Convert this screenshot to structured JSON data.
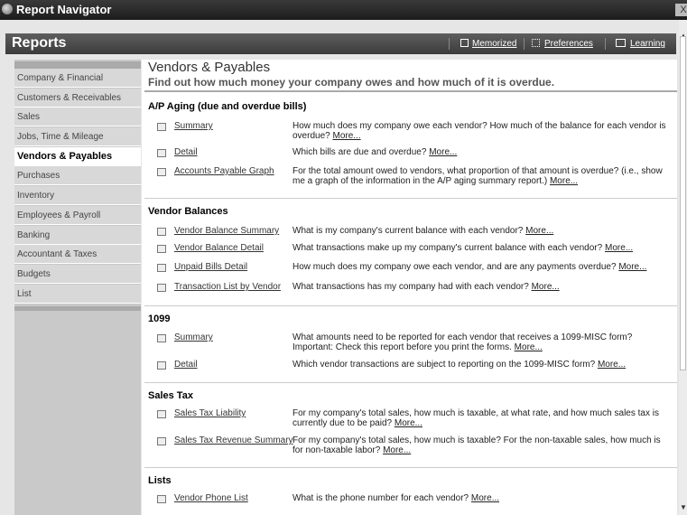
{
  "window": {
    "title": "Report Navigator",
    "close": "X"
  },
  "header": {
    "title": "Reports",
    "memorized": "Memorized",
    "preferences": "Preferences",
    "learning": "Learning"
  },
  "sidebar": {
    "items": [
      "Company & Financial",
      "Customers & Receivables",
      "Sales",
      "Jobs, Time & Mileage",
      "Vendors & Payables",
      "Purchases",
      "Inventory",
      "Employees & Payroll",
      "Banking",
      "Accountant & Taxes",
      "Budgets",
      "List"
    ],
    "active": "Vendors & Payables"
  },
  "page": {
    "title": "Vendors & Payables",
    "subtitle": "Find out how much money your company owes and how much of it is overdue."
  },
  "more": "More...",
  "sections": [
    {
      "title": "A/P Aging (due and overdue bills)",
      "reports": [
        {
          "name": "Summary",
          "desc": "How much does my company owe each vendor? How much of the balance for each vendor is overdue?"
        },
        {
          "name": "Detail",
          "desc": "Which bills are due and overdue?"
        },
        {
          "name": "Accounts Payable Graph",
          "desc": "For the total amount owed to vendors, what proportion of that amount is overdue? (i.e., show me a graph of the information in the A/P aging summary report.)"
        }
      ]
    },
    {
      "title": "Vendor Balances",
      "reports": [
        {
          "name": "Vendor Balance Summary",
          "desc": "What is my company's current balance with each vendor?"
        },
        {
          "name": "Vendor Balance Detail",
          "desc": "What transactions make up my company's current balance with each vendor?"
        },
        {
          "name": "Unpaid Bills Detail",
          "desc": "How much does my company owe each vendor, and are any payments overdue?"
        },
        {
          "name": "Transaction List by Vendor",
          "desc": "What transactions has my company had with each vendor?"
        }
      ]
    },
    {
      "title": "1099",
      "reports": [
        {
          "name": "Summary",
          "desc": "What amounts need to be reported for each vendor that receives a 1099-MISC form? Important: Check this report before you print the forms."
        },
        {
          "name": "Detail",
          "desc": "Which vendor transactions are subject to reporting on the 1099-MISC form?"
        }
      ]
    },
    {
      "title": "Sales Tax",
      "reports": [
        {
          "name": "Sales Tax Liability",
          "desc": "For my company's total sales, how much is taxable, at what rate, and how much sales tax is currently due to be paid?"
        },
        {
          "name": "Sales Tax Revenue Summary",
          "desc": "For my company's total sales, how much is taxable? For the non-taxable sales, how much is for non-taxable labor?"
        }
      ]
    },
    {
      "title": "Lists",
      "reports": [
        {
          "name": "Vendor Phone List",
          "desc": "What is the phone number for each vendor?"
        }
      ]
    }
  ]
}
